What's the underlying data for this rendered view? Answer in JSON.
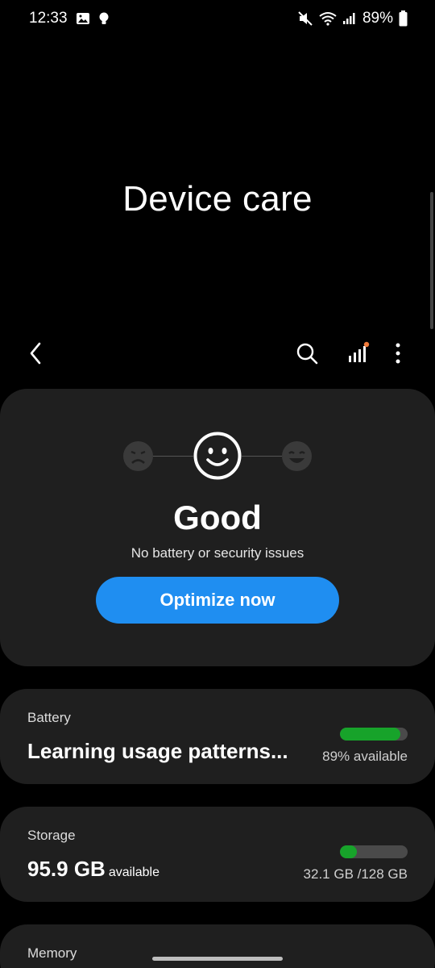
{
  "status_bar": {
    "time": "12:33",
    "battery_pct": "89%"
  },
  "header": {
    "title": "Device care"
  },
  "status": {
    "word": "Good",
    "subtitle": "No battery or security issues",
    "optimize_label": "Optimize now"
  },
  "battery": {
    "title": "Battery",
    "main": "Learning usage patterns...",
    "right": "89% available",
    "fill_fraction": 0.89
  },
  "storage": {
    "title": "Storage",
    "main": "95.9 GB",
    "main_suffix": "available",
    "right": "32.1 GB /128 GB",
    "fill_fraction": 0.25
  },
  "memory": {
    "title": "Memory"
  },
  "colors": {
    "accent": "#1f8ef1",
    "bar_green": "#17a32a",
    "notification_dot": "#f07a3a"
  }
}
